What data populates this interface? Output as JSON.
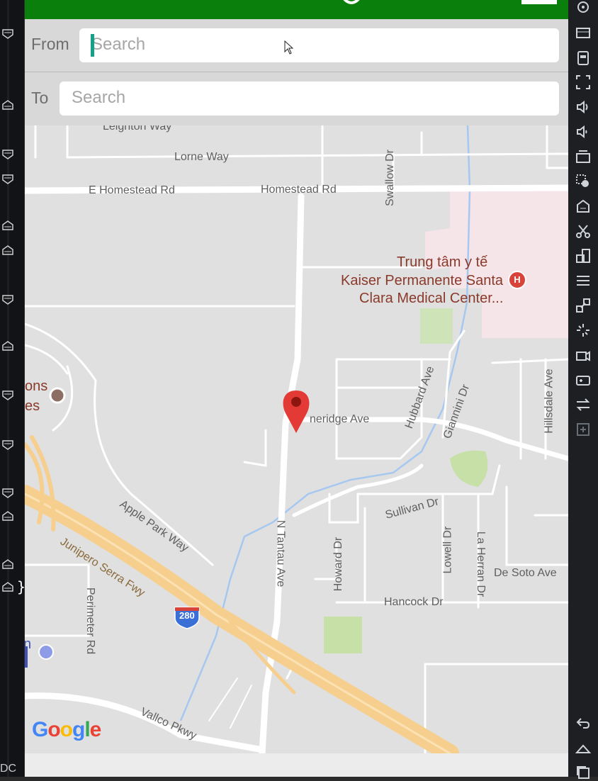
{
  "app": {
    "from_label": "From",
    "to_label": "To",
    "from_placeholder": "Search",
    "to_placeholder": "Search",
    "accent_color": "#0b7f0b"
  },
  "map": {
    "streets": {
      "leighton": "Leighton Way",
      "lorne": "Lorne Way",
      "e_homestead": "E Homestead Rd",
      "homestead": "Homestead Rd",
      "swallow": "Swallow Dr",
      "hubbard": "Hubbard Ave",
      "giannini": "Giannini Dr",
      "hillsdale": "Hillsdale Ave",
      "pineridge": "neridge Ave",
      "apple_park": "Apple Park Way",
      "junipero": "Junipero Serra Fwy",
      "tantau": "N Tantau Ave",
      "sullivan": "Sullivan Dr",
      "howard": "Howard Dr",
      "lowell": "Lowell Dr",
      "la_herran": "La Herran Dr",
      "de_soto": "De Soto Ave",
      "hancock": "Hancock Dr",
      "perimeter": "Perimeter Rd",
      "vallco": "Vallco Pkwy"
    },
    "hospital_line1": "Trung tâm y tế",
    "hospital_line2": "Kaiser Permanente Santa",
    "hospital_line3": "Clara Medical Center...",
    "hospital_badge": "H",
    "left_poi_line1": "ons",
    "left_poi_line2": "es",
    "left_edge_letter": "n",
    "highway_shield": "280",
    "logo": "Google",
    "marker_icon": "map-pin-icon"
  },
  "ide": {
    "gutter_text": "DC",
    "brace": "}"
  }
}
